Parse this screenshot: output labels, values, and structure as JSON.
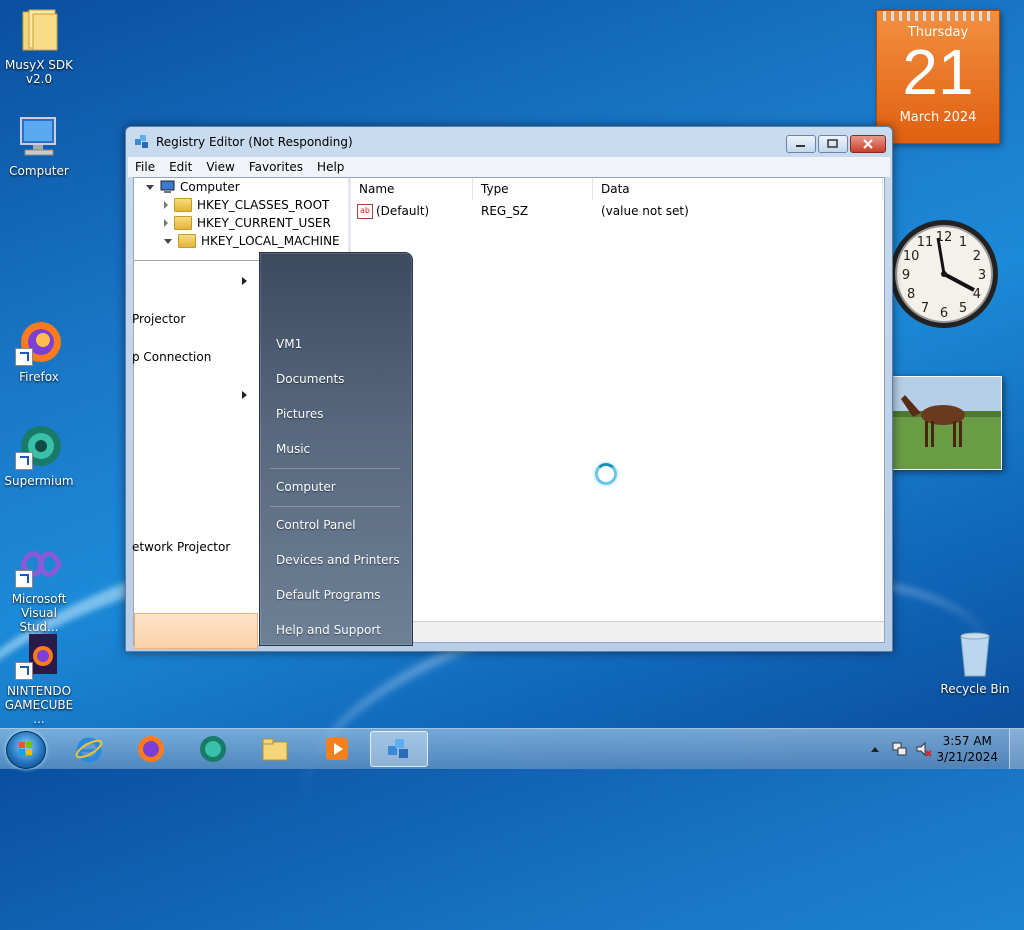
{
  "desktop": {
    "icons": [
      {
        "name": "desktop-icon-musyx",
        "label": "MusyX SDK v2.0",
        "icon": "folder-icon"
      },
      {
        "name": "desktop-icon-computer",
        "label": "Computer",
        "icon": "computer-icon"
      },
      {
        "name": "desktop-icon-firefox",
        "label": "Firefox",
        "icon": "firefox-icon"
      },
      {
        "name": "desktop-icon-supermium",
        "label": "Supermium",
        "icon": "supermium-icon"
      },
      {
        "name": "desktop-icon-vs",
        "label": "Microsoft Visual Stud...",
        "icon": "visual-studio-icon"
      },
      {
        "name": "desktop-icon-gamecube",
        "label": "NINTENDO GAMECUBE ...",
        "icon": "gamecube-icon"
      },
      {
        "name": "desktop-icon-recycle",
        "label": "Recycle Bin",
        "icon": "recycle-bin-icon"
      }
    ]
  },
  "gadgets": {
    "calendar": {
      "weekday": "Thursday",
      "day": "21",
      "month_year": "March 2024"
    },
    "clock": {
      "numerals": [
        "12",
        "1",
        "2",
        "3",
        "4",
        "5",
        "6",
        "7",
        "8",
        "9",
        "10",
        "11"
      ]
    }
  },
  "regedit": {
    "title": "Registry Editor (Not Responding)",
    "menu": [
      "File",
      "Edit",
      "View",
      "Favorites",
      "Help"
    ],
    "tree": [
      {
        "label": "Computer",
        "expanded": true
      },
      {
        "label": "HKEY_CLASSES_ROOT",
        "expanded": false
      },
      {
        "label": "HKEY_CURRENT_USER",
        "expanded": false
      },
      {
        "label": "HKEY_LOCAL_MACHINE",
        "expanded": true
      }
    ],
    "columns": [
      "Name",
      "Type",
      "Data"
    ],
    "rows": [
      {
        "name": "(Default)",
        "type": "REG_SZ",
        "data": "(value not set)"
      }
    ],
    "value_icon": "ab"
  },
  "start_menu": {
    "left_items": [
      "Projector",
      "p Connection",
      "etwork Projector"
    ],
    "right_items": [
      "VM1",
      "Documents",
      "Pictures",
      "Music",
      "Computer",
      "Control Panel",
      "Devices and Printers",
      "Default Programs",
      "Help and Support"
    ]
  },
  "taskbar": {
    "pinned": [
      "ie-icon",
      "firefox-icon",
      "supermium-icon",
      "explorer-icon",
      "media-player-icon",
      "regedit-icon"
    ],
    "time": "3:57 AM",
    "date": "3/21/2024"
  }
}
